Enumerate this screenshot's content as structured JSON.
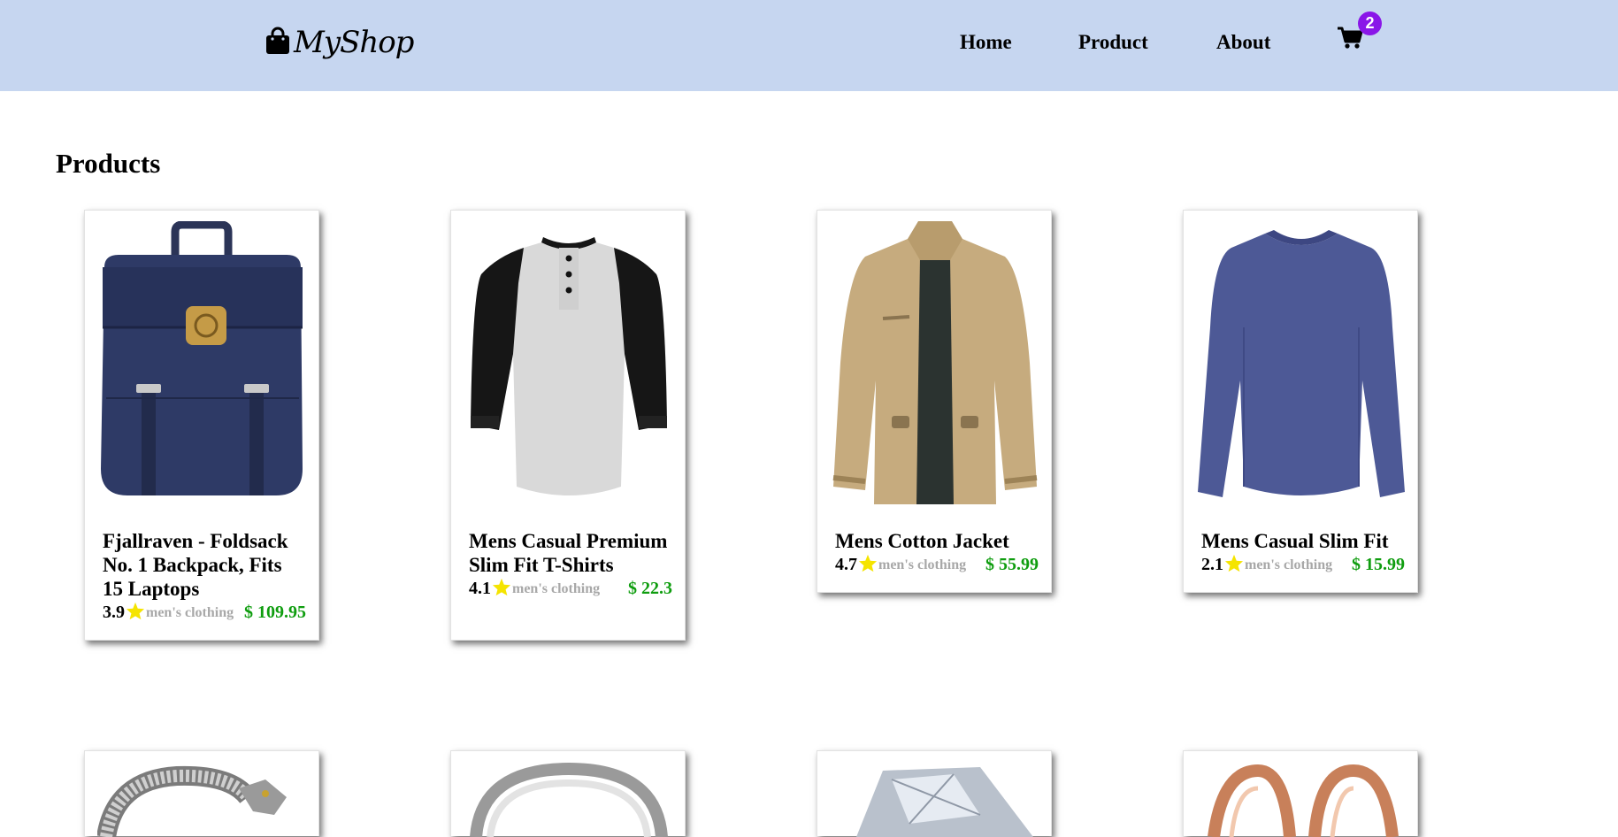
{
  "brand": {
    "name": "MyShop",
    "icon": "shopping-bag-icon"
  },
  "nav": [
    {
      "label": "Home"
    },
    {
      "label": "Product"
    },
    {
      "label": "About"
    }
  ],
  "cart": {
    "count": "2",
    "icon": "shopping-cart-icon"
  },
  "page": {
    "title": "Products"
  },
  "products": [
    {
      "title": "Fjallraven - Foldsack No. 1 Backpack, Fits 15 Laptops",
      "rating": "3.9",
      "category": "men's clothing",
      "price": "$ 109.95",
      "image": "backpack"
    },
    {
      "title": "Mens Casual Premium Slim Fit T-Shirts",
      "rating": "4.1",
      "category": "men's clothing",
      "price": "$ 22.3",
      "image": "raglan-tshirt"
    },
    {
      "title": "Mens Cotton Jacket",
      "rating": "4.7",
      "category": "men's clothing",
      "price": "$ 55.99",
      "image": "cotton-jacket"
    },
    {
      "title": "Mens Casual Slim Fit",
      "rating": "2.1",
      "category": "men's clothing",
      "price": "$ 15.99",
      "image": "slim-fit-shirt"
    }
  ],
  "colors": {
    "navbar": "#c6d6f0",
    "price": "#0f9d0f",
    "category": "#a8a8a8",
    "star": "#f5e400",
    "badge": "#8a16e8"
  }
}
